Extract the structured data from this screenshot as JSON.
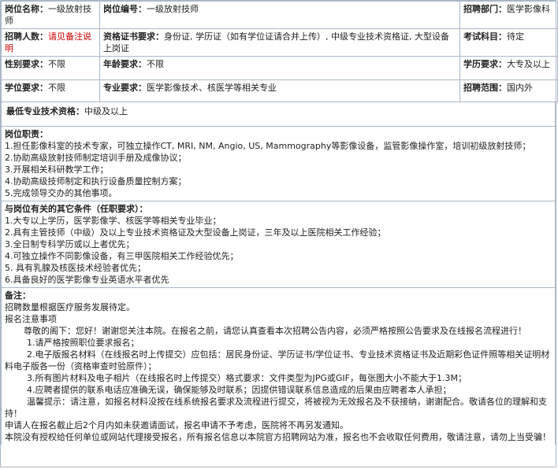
{
  "post": {
    "name_label": "岗位名称：",
    "name_value": "一级放射技师",
    "code_label": "岗位编号：",
    "code_value": "一级放射技师",
    "dept_label": "招聘部门：",
    "dept_value": "医学影像科",
    "count_label": "招聘人数：",
    "count_value": "请见备注说明",
    "cert_label": "资格证书要求：",
    "cert_value": "身份证, 学历证（如有学位证请合并上传）, 中级专业技术资格证, 大型设备上岗证",
    "exam_label": "考试科目：",
    "exam_value": "待定",
    "gender_label": "性别要求：",
    "gender_value": "不限",
    "age_label": "年龄要求：",
    "age_value": "不限",
    "edu_label": "学历要求：",
    "edu_value": "大专及以上",
    "degree_label": "学位要求：",
    "degree_value": "不限",
    "major_label": "专业要求：",
    "major_value": "医学影像技术、核医学等相关专业",
    "range_label": "招聘范围：",
    "range_value": "国内外"
  },
  "min_title": {
    "label": "最低专业技术资格：",
    "value": "中级及以上"
  },
  "duties": {
    "title": "岗位职责：",
    "items": [
      "1.担任影像科室的技术专家，可独立操作CT, MRI, NM, Angio, US, Mammography等影像设备，监管影像操作室，培训初级放射技师；",
      "2.协助高级放射技师制定培训手册及成像协议；",
      "3.开展相关科研教学工作；",
      "4.协助高级技师制定和执行设备质量控制方案；",
      "5.完成领导交办的其他事项。"
    ]
  },
  "conditions": {
    "title": "与岗位有关的其它条件（任职要求）：",
    "items": [
      "1.大专以上学历，医学影像学、核医学等相关专业毕业；",
      "2.具有主管技师（中级）及以上专业技术资格证及大型设备上岗证，三年及以上医院相关工作经验；",
      "3.全日制专科学历或以上者优先；",
      "4.可独立操作不同影像设备，有三甲医院相关工作经验优先；",
      "5. 具有乳腺及核医技术经验者优先；",
      "6.具备良好的医学影像专业英语水平者优先"
    ]
  },
  "notes": {
    "title": "备注：",
    "line1": "招聘数量根据医疗服务发展待定。",
    "line2": "报名注意事项",
    "line3": "尊敬的阁下：您好！谢谢您关注本院。在报名之前，请您认真查看本次招聘公告内容，必须严格按照公告要求及在线报名流程进行！",
    "item1": "1.请严格按照职位要求报名；",
    "item2": "2.电子版报名材料（在线报名时上传提交）应包括：居民身份证、学历证书/学位证书、专业技术资格证书及近期彩色证件照等相关证明材料电子版各一份（资格审查时验原件）；",
    "item3": "3.所有图片材料及电子相片（在线报名时上传提交）格式要求：文件类型为JPG或GIF，每张图大小不能大于1.3M；",
    "item4": "4.应聘者提供的联系电话应准确无误，确保能够及时联系；因提供错误联系信息造成的后果由应聘者本人承担；",
    "tip": "温馨提示：请注意，如报名材料没按在线系统报名要求及流程进行提交，将被视为无效报名及不获接纳，谢谢配合。敬请各位的理解和支持！",
    "line4": "申请人在报名截止后2个月内如未获邀请面试，报名申请不予考虑，医院将不再另发通知。",
    "line5": "本院没有授权给任何单位或网站代理接受报名，所有报名信息以本院官方招聘网站为准，报名也不会收取任何费用，敬请注意，请勿上当受骗！"
  }
}
